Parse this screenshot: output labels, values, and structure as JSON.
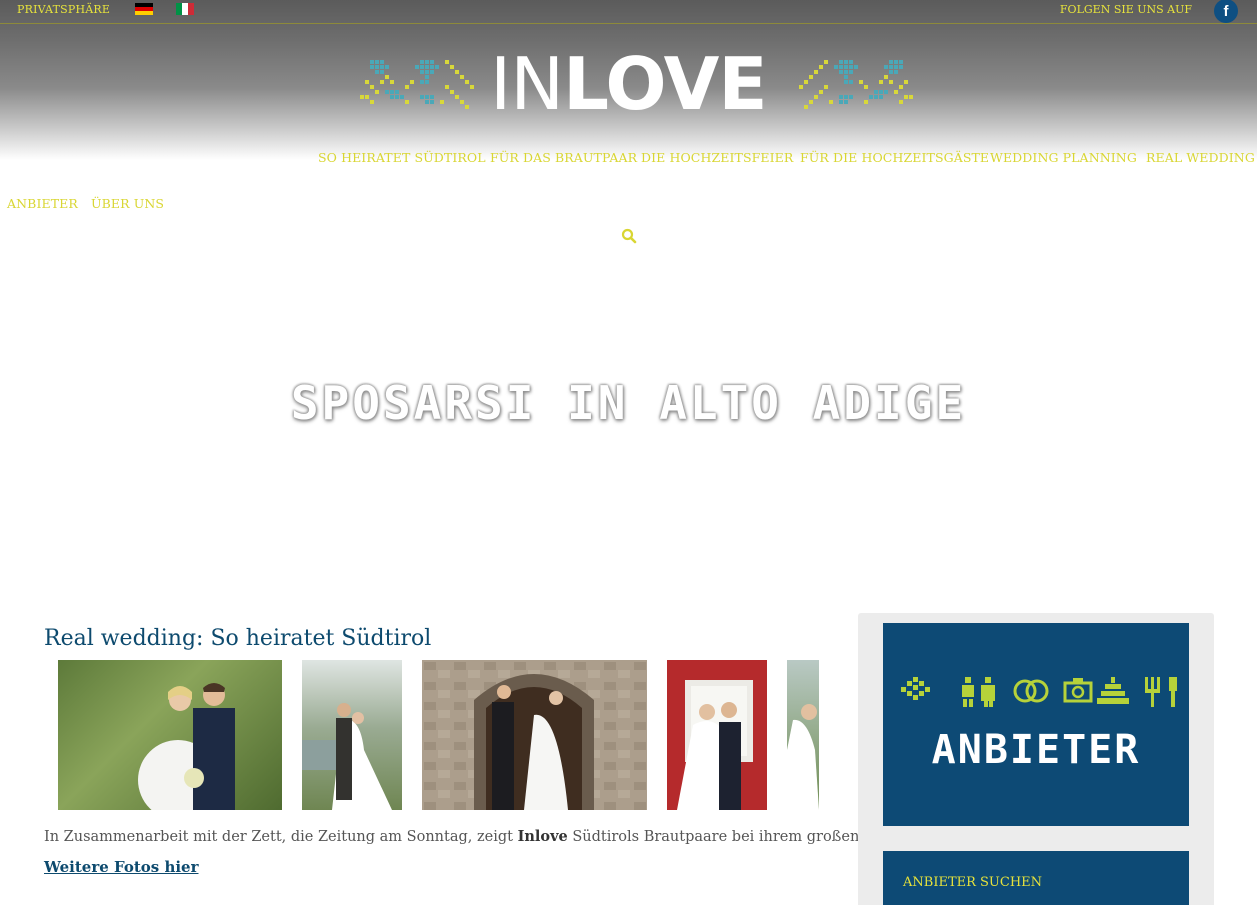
{
  "topbar": {
    "privacy_label": "PRIVATSPHÄRE",
    "languages": [
      "de-flag-icon",
      "it-flag-icon"
    ],
    "follow_label": "FOLGEN SIE UNS AUF",
    "social_icon": "facebook-icon",
    "social_glyph": "f"
  },
  "logo": {
    "light": "IN",
    "bold": "LOVE"
  },
  "nav": {
    "items": [
      "SO HEIRATET SÜDTIROL",
      "FÜR DAS BRAUTPAAR",
      "DIE HOCHZEITSFEIER",
      "FÜR DIE HOCHZEITSGÄSTE",
      "WEDDING PLANNING",
      "REAL WEDDING",
      "ANBIETER",
      "ÜBER UNS"
    ],
    "search_icon": "search-icon"
  },
  "hero": {
    "title": "SPOSARSI IN ALTO ADIGE"
  },
  "article": {
    "title": "Real wedding: So heiratet Südtirol",
    "text_before": "In Zusammenarbeit mit der Zett, die Zeitung am Sonntag, zeigt ",
    "text_bold": "Inlove",
    "text_after": " Südtirols Brautpaare bei ihrem großen Tag!",
    "more_link": "Weitere Fotos hier"
  },
  "sidebar": {
    "vendor_banner_title": "ANBIETER",
    "vendor_search_label": "ANBIETER SUCHEN"
  },
  "colors": {
    "accent_yellow": "#e6e23c",
    "navy": "#0d4a75",
    "facebook": "#0e4f82"
  }
}
